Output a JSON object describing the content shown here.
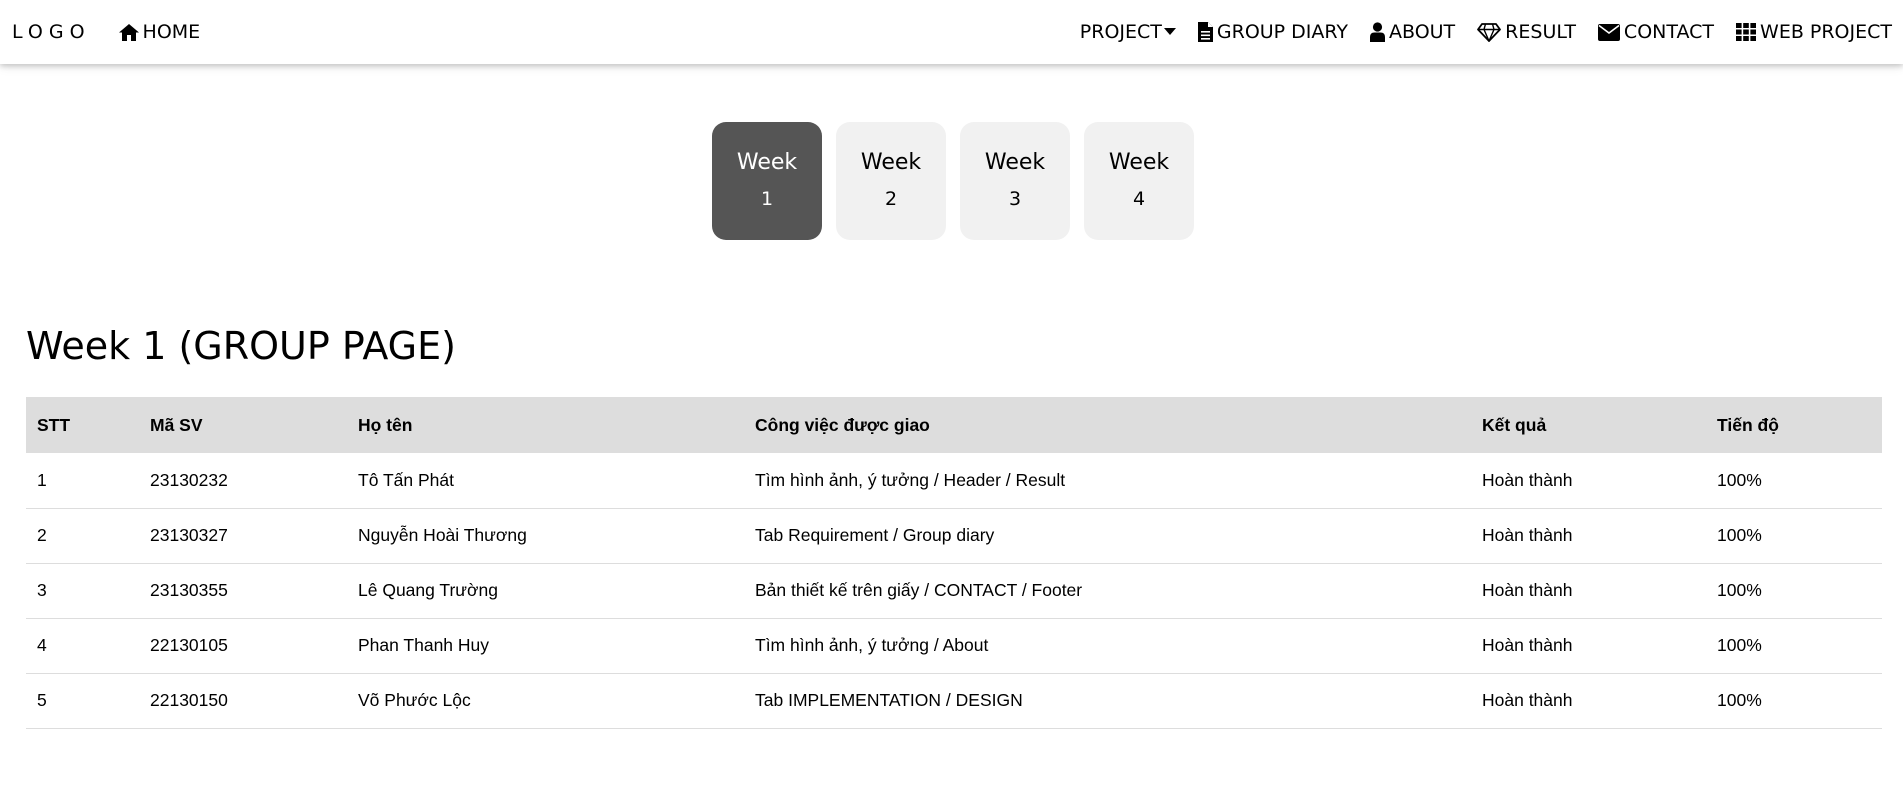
{
  "nav": {
    "logo": "LOGO",
    "home": "HOME",
    "items": [
      {
        "label": "PROJECT",
        "icon": "caret-down-icon"
      },
      {
        "label": "GROUP DIARY",
        "icon": "file-icon"
      },
      {
        "label": "ABOUT",
        "icon": "user-icon"
      },
      {
        "label": "RESULT",
        "icon": "diamond-icon"
      },
      {
        "label": "CONTACT",
        "icon": "envelope-icon"
      },
      {
        "label": "WEB PROJECT",
        "icon": "grid-icon"
      }
    ]
  },
  "weeks": [
    {
      "label": "Week",
      "number": "1",
      "active": true
    },
    {
      "label": "Week",
      "number": "2",
      "active": false
    },
    {
      "label": "Week",
      "number": "3",
      "active": false
    },
    {
      "label": "Week",
      "number": "4",
      "active": false
    }
  ],
  "page_title": "Week 1 (GROUP PAGE)",
  "table": {
    "headers": [
      "STT",
      "Mã SV",
      "Họ tên",
      "Công việc được giao",
      "Kết quả",
      "Tiến độ"
    ],
    "rows": [
      [
        "1",
        "23130232",
        "Tô Tấn Phát",
        "Tìm hình ảnh, ý tưởng / Header / Result",
        "Hoàn thành",
        "100%"
      ],
      [
        "2",
        "23130327",
        "Nguyễn Hoài Thương",
        "Tab Requirement / Group diary",
        "Hoàn thành",
        "100%"
      ],
      [
        "3",
        "23130355",
        "Lê Quang Trường",
        "Bản thiết kế trên giấy / CONTACT / Footer",
        "Hoàn thành",
        "100%"
      ],
      [
        "4",
        "22130105",
        "Phan Thanh Huy",
        "Tìm hình ảnh, ý tưởng / About",
        "Hoàn thành",
        "100%"
      ],
      [
        "5",
        "22130150",
        "Võ Phước Lộc",
        "Tab IMPLEMENTATION / DESIGN",
        "Hoàn thành",
        "100%"
      ]
    ]
  },
  "colors": {
    "active_tab": "#555555",
    "inactive_tab": "#f1f1f1",
    "table_header": "#dddddd"
  }
}
